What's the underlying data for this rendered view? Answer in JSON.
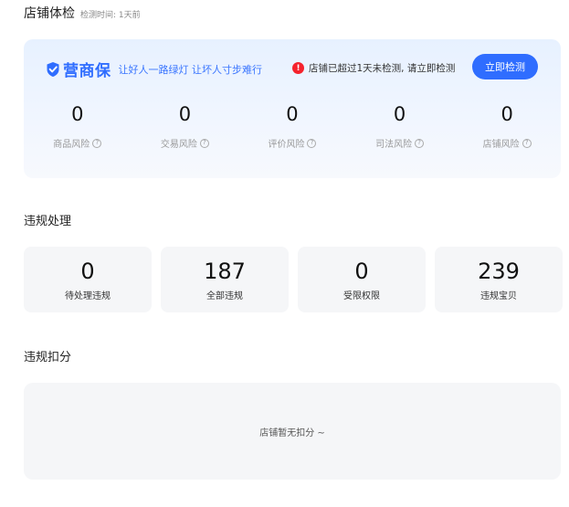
{
  "header": {
    "title": "店铺体检",
    "check_time": "检测时间: 1天前"
  },
  "check_card": {
    "brand_name": "营商保",
    "slogan": "让好人一路绿灯 让坏人寸步难行",
    "alert_text": "店铺已超过1天未检测, 请立即检测",
    "check_button": "立即检测",
    "brand_color": "#2f6dff",
    "risks": [
      {
        "value": "0",
        "label": "商品风险"
      },
      {
        "value": "0",
        "label": "交易风险"
      },
      {
        "value": "0",
        "label": "评价风险"
      },
      {
        "value": "0",
        "label": "司法风险"
      },
      {
        "value": "0",
        "label": "店铺风险"
      }
    ]
  },
  "violations": {
    "title": "违规处理",
    "items": [
      {
        "value": "0",
        "label": "待处理违规"
      },
      {
        "value": "187",
        "label": "全部违规"
      },
      {
        "value": "0",
        "label": "受限权限"
      },
      {
        "value": "239",
        "label": "违规宝贝"
      }
    ]
  },
  "deductions": {
    "title": "违规扣分",
    "empty_text": "店铺暂无扣分 ~"
  }
}
